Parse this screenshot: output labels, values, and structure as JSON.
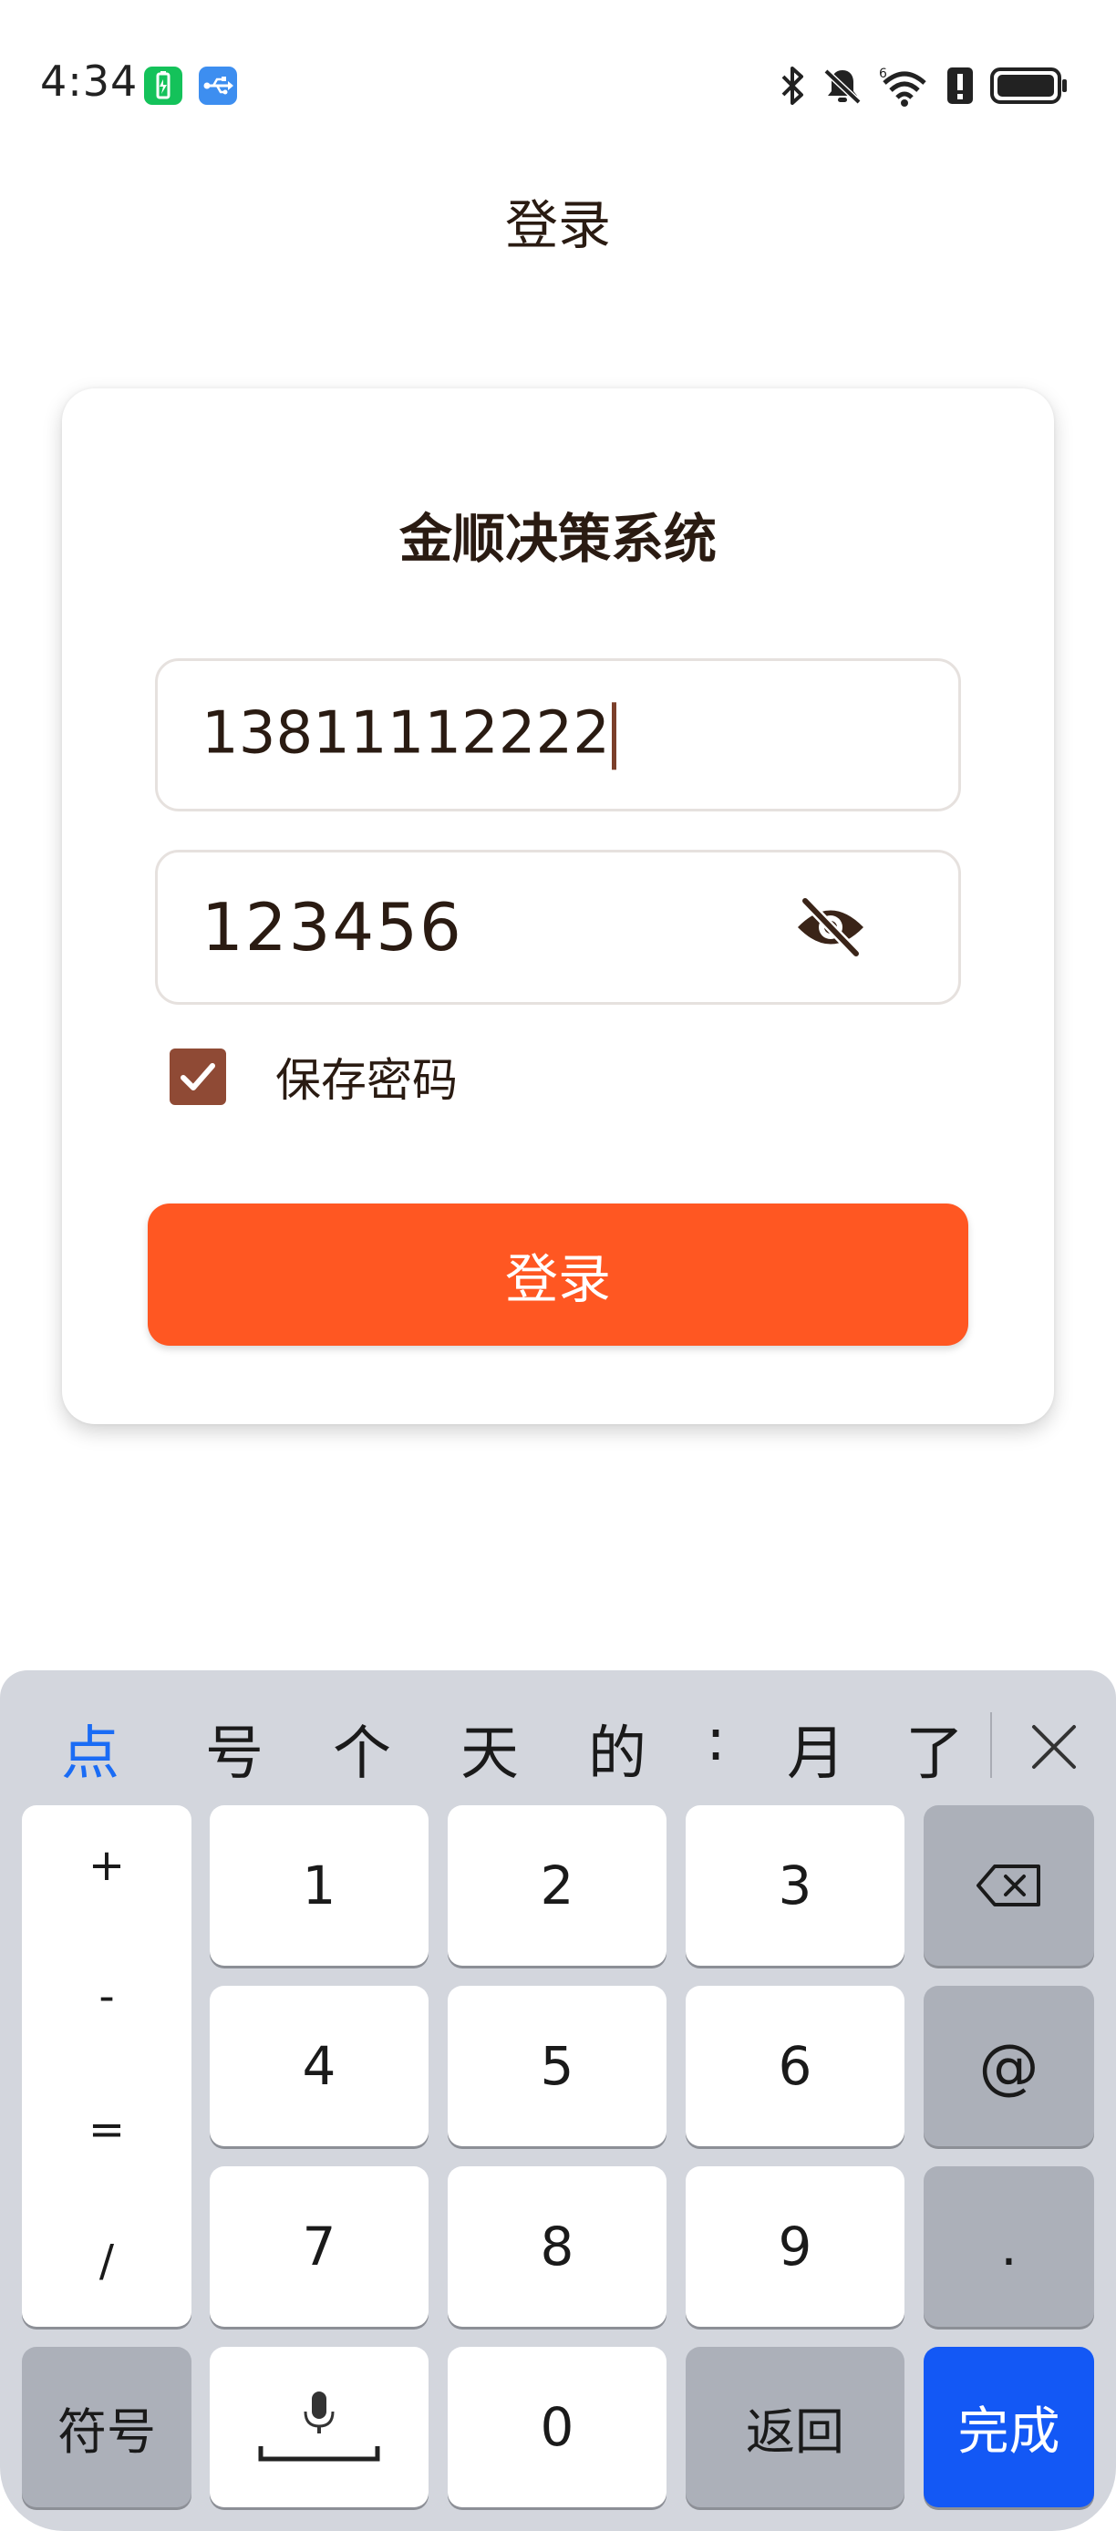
{
  "status_bar": {
    "time": "4:34",
    "icons_left": [
      "battery-saver-icon",
      "usb-icon"
    ],
    "icons_right": [
      "bluetooth-icon",
      "bell-off-icon",
      "wifi-icon",
      "alert-icon",
      "battery-icon"
    ],
    "wifi_badge": "6"
  },
  "app_bar": {
    "title": "登录"
  },
  "card": {
    "system_name": "金顺决策系统",
    "phone_value": "13811112222",
    "password_value": "123456",
    "remember_checked": true,
    "remember_label": "保存密码",
    "login_label": "登录"
  },
  "colors": {
    "accent": "#ff5722",
    "checkbox": "#8f4a35",
    "keyboard_done": "#1358f5"
  },
  "keyboard": {
    "candidates": [
      "点",
      "号",
      "个",
      "天",
      "的",
      ":",
      "月",
      "了"
    ],
    "symbols": [
      "+",
      "-",
      "=",
      "/"
    ],
    "digits": [
      "1",
      "2",
      "3",
      "4",
      "5",
      "6",
      "7",
      "8",
      "9"
    ],
    "at": "@",
    "dot": ".",
    "fuhao": "符号",
    "zero": "0",
    "back": "返回",
    "done": "完成"
  }
}
